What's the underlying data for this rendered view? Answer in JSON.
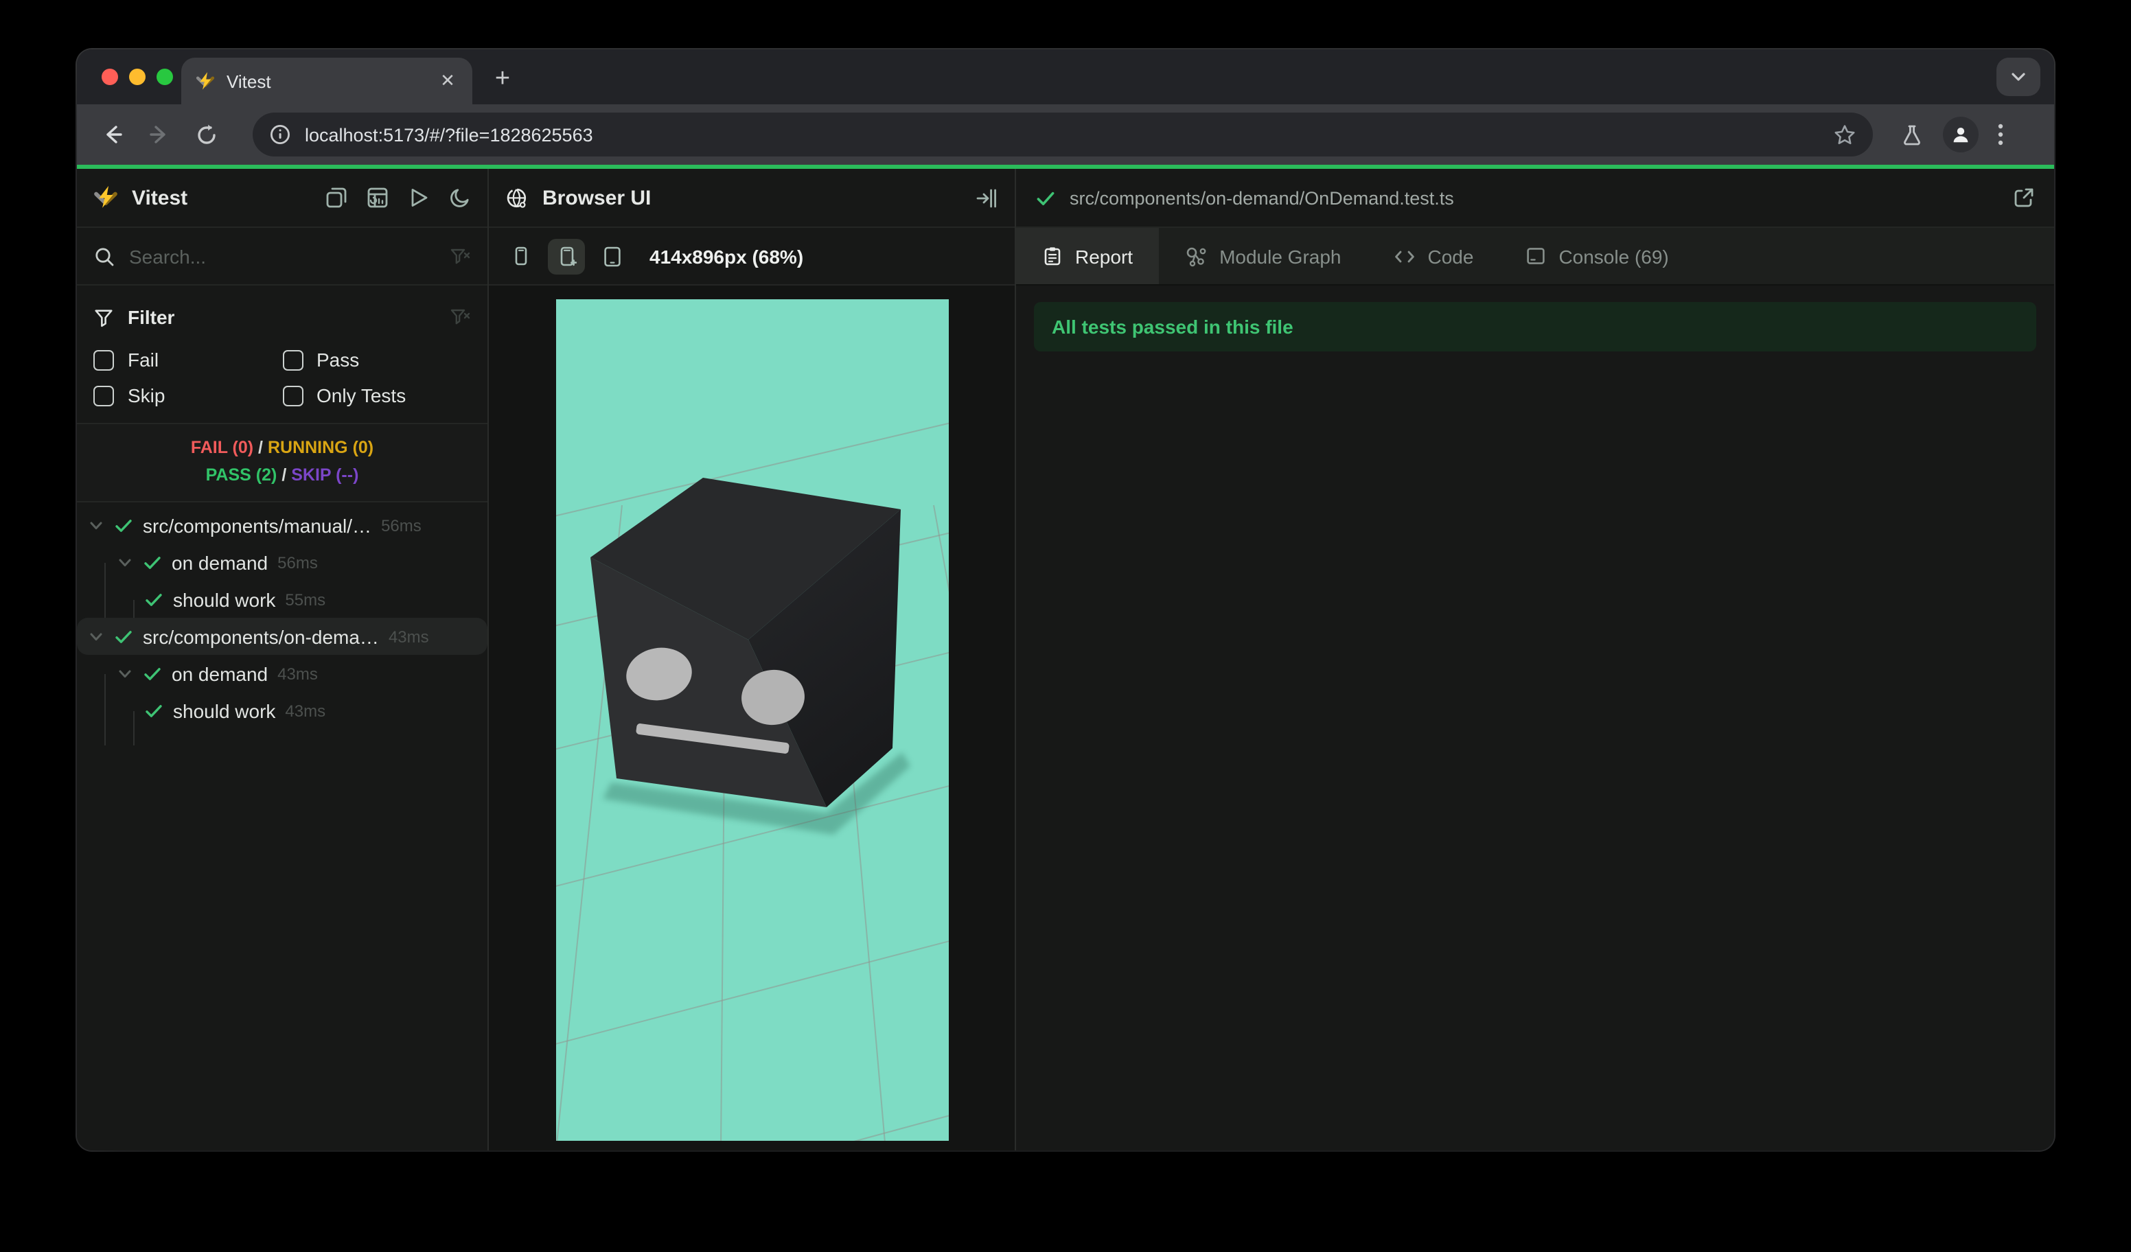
{
  "chrome": {
    "tab_title": "Vitest",
    "close_tab_glyph": "✕",
    "new_tab_glyph": "+",
    "url": "localhost:5173/#/?file=1828625563"
  },
  "sidebar": {
    "title": "Vitest",
    "search_placeholder": "Search...",
    "filter": {
      "title": "Filter",
      "options": [
        "Fail",
        "Pass",
        "Skip",
        "Only Tests"
      ]
    },
    "summary": {
      "fail": "FAIL (0)",
      "running": "RUNNING (0)",
      "pass": "PASS (2)",
      "skip": "SKIP (--)",
      "separator": "/"
    },
    "tree": [
      {
        "level": "file",
        "label": "src/components/manual/…",
        "time": "56ms",
        "selected": false
      },
      {
        "level": "suite",
        "label": "on demand",
        "time": "56ms",
        "selected": false
      },
      {
        "level": "test",
        "label": "should work",
        "time": "55ms",
        "selected": false
      },
      {
        "level": "file",
        "label": "src/components/on-dema…",
        "time": "43ms",
        "selected": true
      },
      {
        "level": "suite",
        "label": "on demand",
        "time": "43ms",
        "selected": false
      },
      {
        "level": "test",
        "label": "should work",
        "time": "43ms",
        "selected": false
      }
    ]
  },
  "preview": {
    "title": "Browser UI",
    "dimensions_label": "414x896px (68%)",
    "scene_background": "#7edcc4"
  },
  "detail": {
    "file_path": "src/components/on-demand/OnDemand.test.ts",
    "tabs": [
      {
        "label": "Report",
        "icon": "report",
        "active": true
      },
      {
        "label": "Module Graph",
        "icon": "graph",
        "active": false
      },
      {
        "label": "Code",
        "icon": "code",
        "active": false
      },
      {
        "label": "Console (69)",
        "icon": "console",
        "active": false
      }
    ],
    "banner": "All tests passed in this file"
  },
  "colors": {
    "accent_green": "#2bbc5b",
    "pass_green": "#31c368",
    "fail_red": "#f15b5b",
    "running_yellow": "#d9a513",
    "skip_purple": "#7b46c8",
    "preview_teal": "#7edcc4",
    "banner_bg": "#15281b",
    "banner_text": "#3fc573"
  }
}
